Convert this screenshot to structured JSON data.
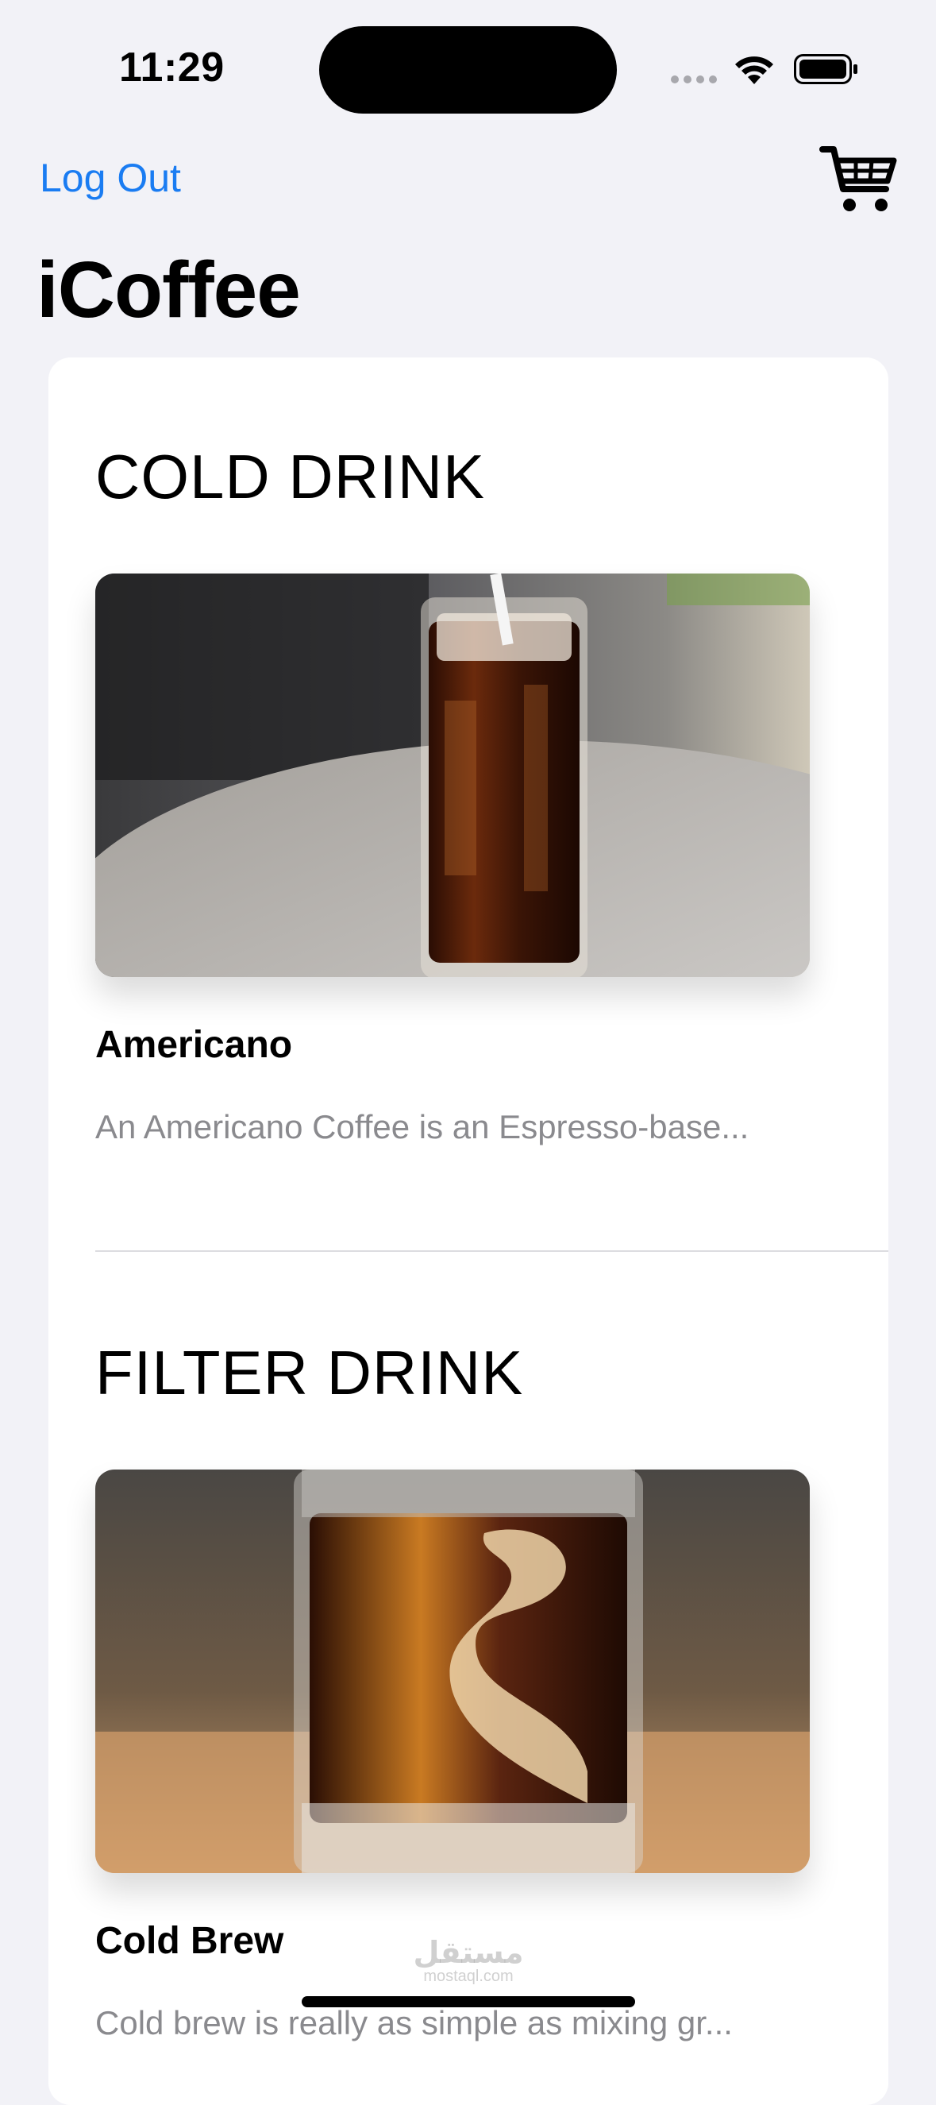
{
  "status_bar": {
    "time": "11:29"
  },
  "nav": {
    "logout_label": "Log Out",
    "cart_icon": "cart-icon"
  },
  "app": {
    "title": "iCoffee"
  },
  "sections": [
    {
      "title": "COLD DRINK",
      "product": {
        "name": "Americano",
        "description": "An Americano Coffee is an Espresso-base..."
      }
    },
    {
      "title": "FILTER DRINK",
      "product": {
        "name": "Cold Brew",
        "description": "Cold brew is really as simple as mixing gr..."
      }
    }
  ],
  "watermark": {
    "text": "مستقل",
    "sub": "mostaql.com"
  },
  "colors": {
    "accent": "#1a7cf2",
    "background": "#f2f2f7",
    "card": "#ffffff",
    "muted_text": "#8a8a8e"
  }
}
